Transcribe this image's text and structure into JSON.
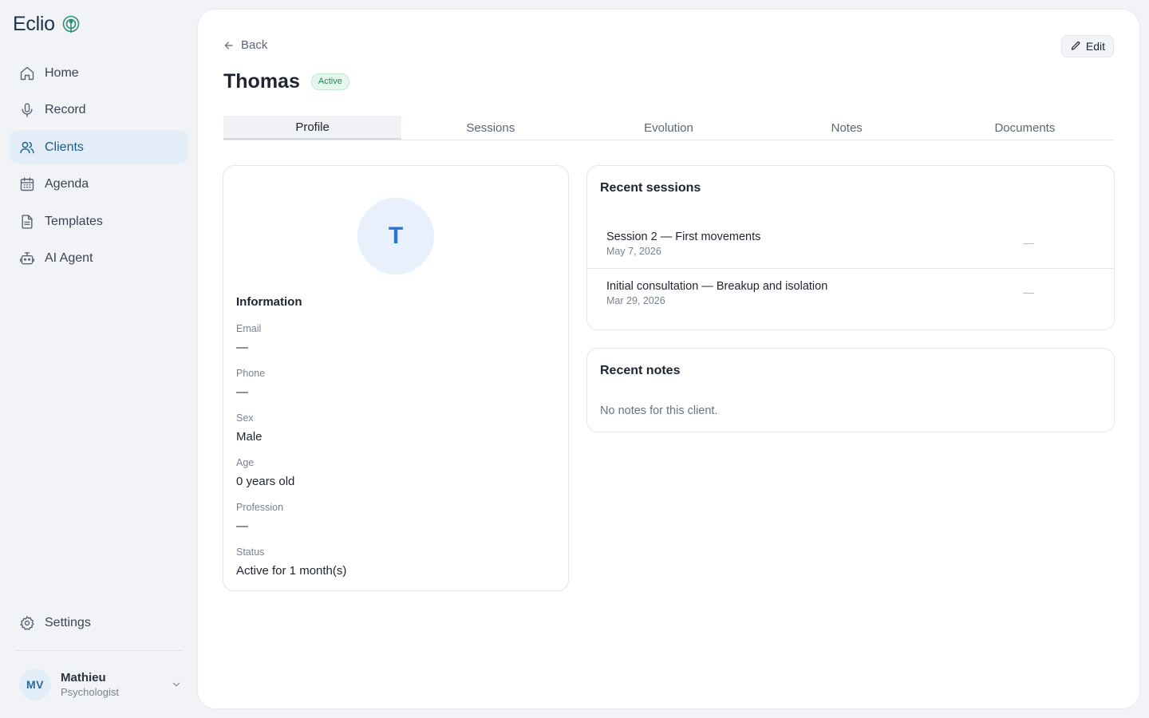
{
  "brand": {
    "name": "Eclio"
  },
  "sidebar": {
    "items": [
      {
        "label": "Home",
        "icon": "home-icon"
      },
      {
        "label": "Record",
        "icon": "microphone-icon"
      },
      {
        "label": "Clients",
        "icon": "users-icon",
        "active": true
      },
      {
        "label": "Agenda",
        "icon": "calendar-icon"
      },
      {
        "label": "Templates",
        "icon": "document-icon"
      },
      {
        "label": "AI Agent",
        "icon": "robot-icon"
      }
    ],
    "settings_label": "Settings"
  },
  "user": {
    "initials": "MV",
    "name": "Mathieu",
    "role": "Psychologist"
  },
  "header": {
    "back_label": "Back",
    "edit_label": "Edit",
    "client_name": "Thomas",
    "status_badge": "Active"
  },
  "tabs": [
    "Profile",
    "Sessions",
    "Evolution",
    "Notes",
    "Documents"
  ],
  "profile": {
    "avatar_initial": "T",
    "section_title": "Information",
    "fields": [
      {
        "label": "Email",
        "value": "—"
      },
      {
        "label": "Phone",
        "value": "—"
      },
      {
        "label": "Sex",
        "value": "Male"
      },
      {
        "label": "Age",
        "value": "0 years old"
      },
      {
        "label": "Profession",
        "value": "—"
      },
      {
        "label": "Status",
        "value": "Active for 1 month(s)"
      }
    ]
  },
  "recent_sessions": {
    "title": "Recent sessions",
    "items": [
      {
        "title": "Session 2 — First movements",
        "date": "May 7, 2026",
        "extra": "—"
      },
      {
        "title": "Initial consultation — Breakup and isolation",
        "date": "Mar 29, 2026",
        "extra": "—"
      }
    ]
  },
  "recent_notes": {
    "title": "Recent notes",
    "empty_text": "No notes for this client."
  },
  "colors": {
    "accent": "#1d5c87",
    "active_nav_bg": "#e3edf7",
    "badge_green": "#1e8a5c",
    "avatar_blue": "#2a73d9"
  }
}
